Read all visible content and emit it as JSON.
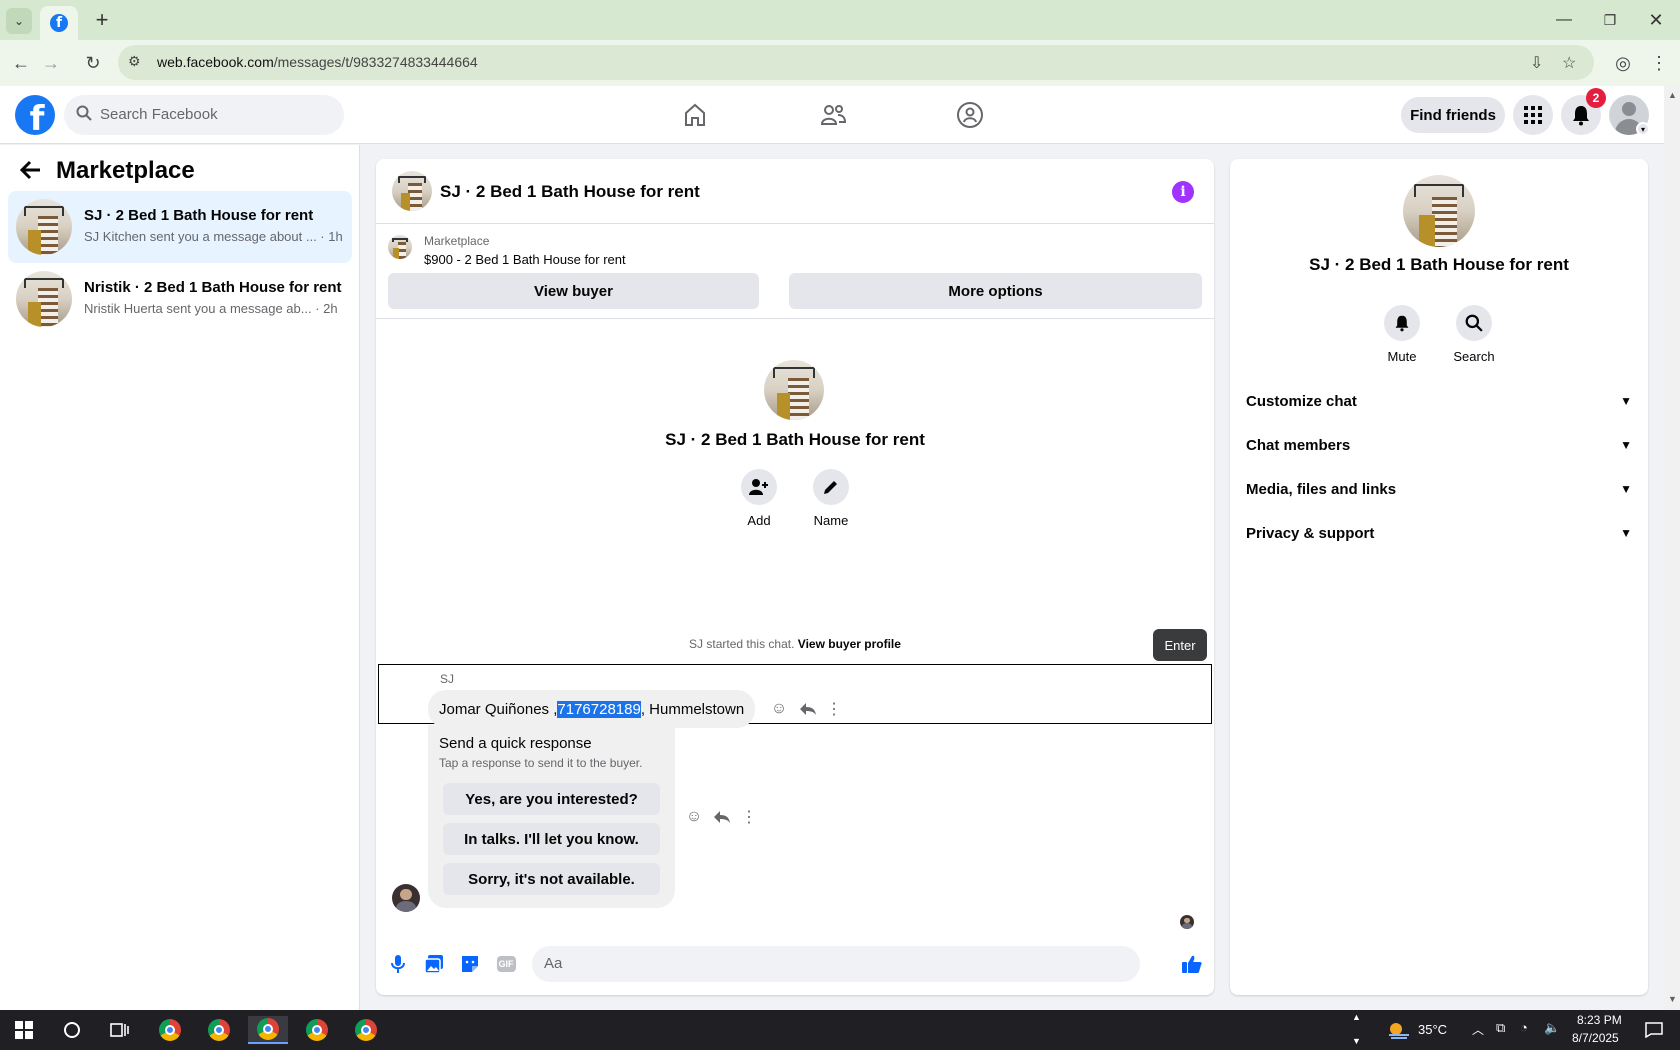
{
  "browser": {
    "url_host": "web.facebook.com",
    "url_path": "/messages/t/9833274833444664",
    "new_tab_label": "+"
  },
  "header": {
    "search_placeholder": "Search Facebook",
    "find_friends": "Find friends",
    "notification_count": "2"
  },
  "sidebar": {
    "title": "Marketplace",
    "conversations": [
      {
        "name": "SJ · 2 Bed 1 Bath House for rent",
        "preview": "SJ Kitchen sent you a message about ... · 1h",
        "active": true
      },
      {
        "name": "Nristik · 2 Bed 1 Bath House for rent",
        "preview": "Nristik Huerta sent you a message ab... · 2h",
        "active": false
      }
    ]
  },
  "chat": {
    "title": "SJ · 2 Bed 1 Bath House for rent",
    "marketplace_label": "Marketplace",
    "listing": "$900 - 2 Bed 1 Bath House for rent",
    "view_buyer": "View buyer",
    "more_options": "More options",
    "profile_title": "SJ · 2 Bed 1 Bath House for rent",
    "add_label": "Add",
    "name_label": "Name",
    "started_text": "SJ started this chat.",
    "view_buyer_profile": "View buyer profile",
    "enter_tooltip": "Enter",
    "sender": "SJ",
    "message": {
      "part1": "Jomar Quiñones , ",
      "highlight": "7176728189",
      "part2": " , Hummelstown"
    },
    "quick_response": {
      "heading": "Send a quick response",
      "subtext": "Tap a response to send it to the buyer.",
      "options": [
        "Yes, are you interested?",
        "In talks. I'll let you know.",
        "Sorry, it's not available."
      ]
    },
    "composer_placeholder": "Aa",
    "gif_label": "GIF"
  },
  "right_panel": {
    "title": "SJ · 2 Bed 1 Bath House for rent",
    "mute": "Mute",
    "search": "Search",
    "sections": [
      "Customize chat",
      "Chat members",
      "Media, files and links",
      "Privacy & support"
    ]
  },
  "taskbar": {
    "temperature": "35°C",
    "time": "8:23 PM",
    "date": "8/7/2025"
  },
  "colors": {
    "fb_blue": "#1877f2",
    "info_purple": "#a033ff",
    "badge_red": "#e41e3f",
    "highlight": "#1a73e8"
  }
}
